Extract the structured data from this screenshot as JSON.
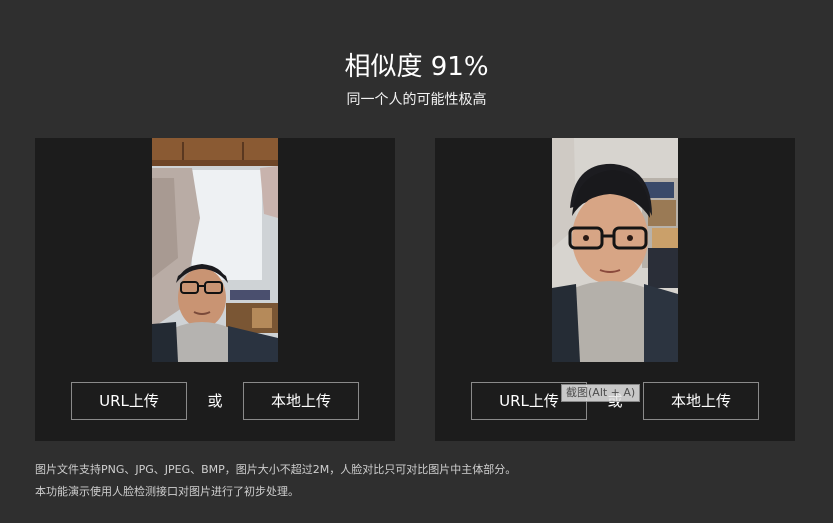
{
  "header": {
    "title": "相似度 91%",
    "subtitle": "同一个人的可能性极高"
  },
  "panels": [
    {
      "url_button": "URL上传",
      "or_label": "或",
      "local_button": "本地上传"
    },
    {
      "url_button": "URL上传",
      "or_label": "或",
      "local_button": "本地上传"
    }
  ],
  "tooltip": "截图(Alt + A)",
  "notes": {
    "line1": "图片文件支持PNG、JPG、JPEG、BMP，图片大小不超过2M，人脸对比只可对比图片中主体部分。",
    "line2": "本功能演示使用人脸检测接口对图片进行了初步处理。"
  },
  "colors": {
    "background": "#2f2f2f",
    "panel": "#1c1c1c",
    "button_border": "#8a8a8a",
    "text": "#ffffff"
  }
}
